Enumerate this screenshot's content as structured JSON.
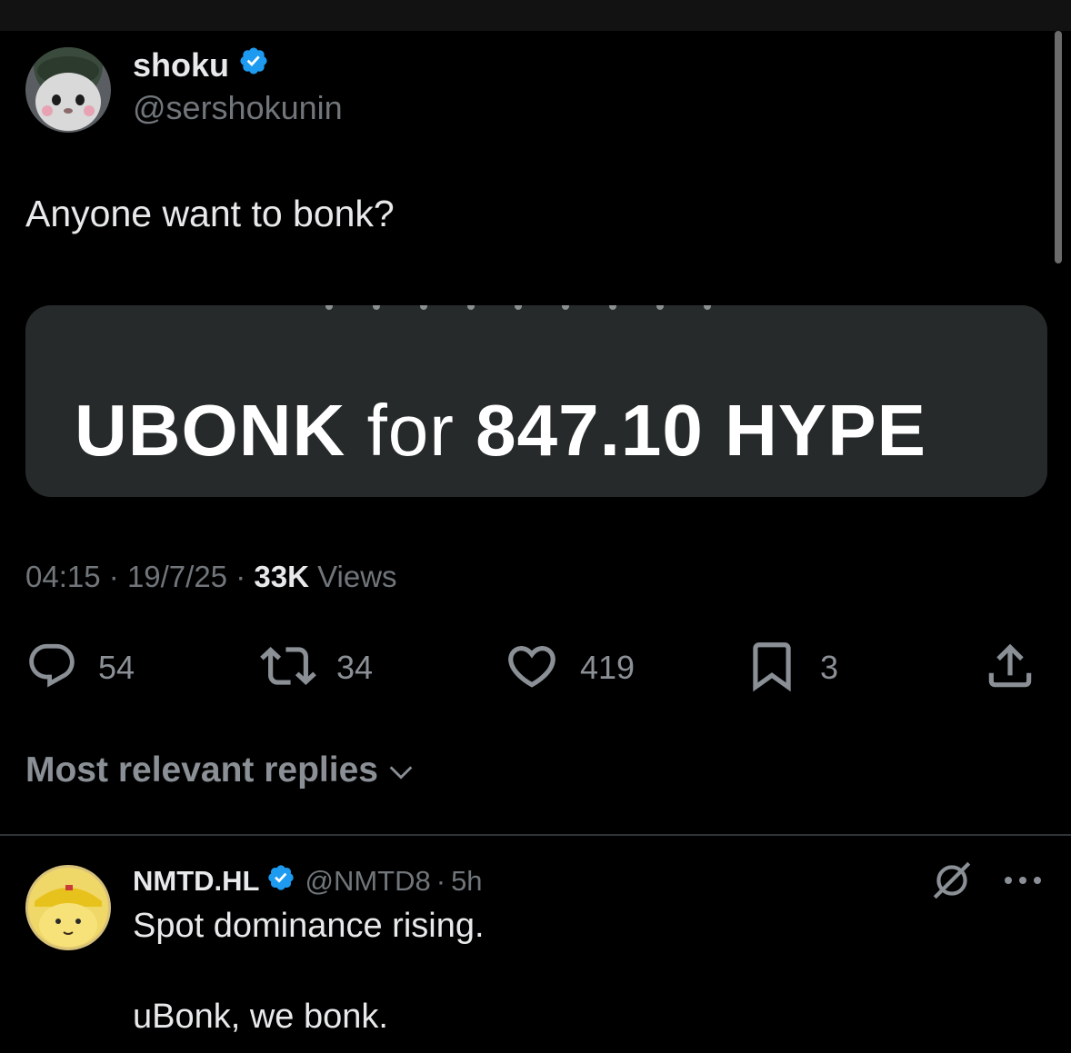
{
  "colors": {
    "background": "#000000",
    "text_primary": "#e7e9ea",
    "text_secondary": "#71767b",
    "verified_badge": "#1d9bf0",
    "media_background": "#262a2b"
  },
  "tweet": {
    "author": {
      "name": "shoku",
      "handle": "@sershokunin",
      "verified": true
    },
    "text": "Anyone want to bonk?",
    "media": {
      "token": "UBONK",
      "connector": "for",
      "amount": "847.10",
      "currency": "HYPE"
    },
    "meta": {
      "time": "04:15",
      "date": "19/7/25",
      "separator": "·",
      "views_count": "33K",
      "views_label": "Views"
    },
    "actions": {
      "reply": {
        "icon": "reply-icon",
        "count": "54"
      },
      "repost": {
        "icon": "repost-icon",
        "count": "34"
      },
      "like": {
        "icon": "heart-icon",
        "count": "419"
      },
      "bookmark": {
        "icon": "bookmark-icon",
        "count": "3"
      },
      "share": {
        "icon": "share-icon"
      }
    }
  },
  "replies_sort": {
    "label": "Most relevant replies",
    "icon": "chevron-down-icon"
  },
  "reply": {
    "author": {
      "name": "NMTD.HL",
      "handle": "@NMTD8",
      "verified": true
    },
    "separator": "·",
    "time": "5h",
    "lines": [
      "Spot dominance rising.",
      "uBonk, we bonk."
    ]
  }
}
